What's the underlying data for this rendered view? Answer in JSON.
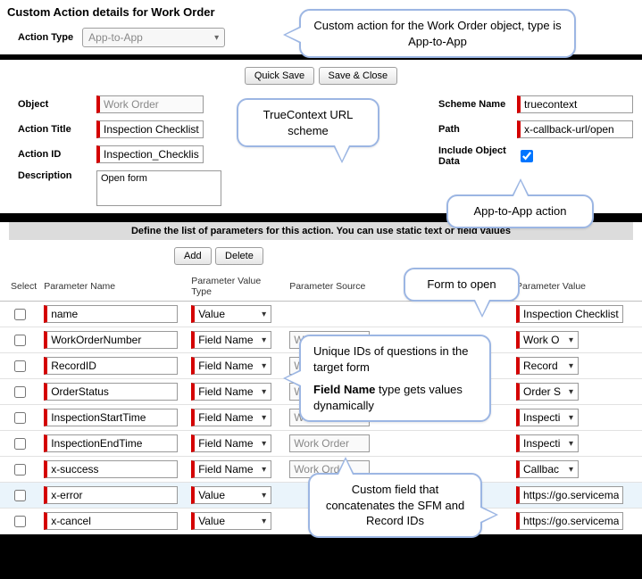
{
  "header": {
    "title": "Custom Action details for Work Order",
    "action_type_label": "Action Type",
    "action_type_value": "App-to-App"
  },
  "toolbar": {
    "quick_save": "Quick Save",
    "save_close": "Save & Close",
    "add": "Add",
    "delete": "Delete"
  },
  "form": {
    "object_label": "Object",
    "object_value": "Work Order",
    "action_title_label": "Action Title",
    "action_title_value": "Inspection Checklist",
    "action_id_label": "Action ID",
    "action_id_value": "Inspection_Checklist",
    "description_label": "Description",
    "description_value": "Open form",
    "scheme_name_label": "Scheme Name",
    "scheme_name_value": "truecontext",
    "path_label": "Path",
    "path_value": "x-callback-url/open",
    "include_label": "Include Object Data"
  },
  "section": {
    "params_header": "Define the list of parameters for this action. You can use static text or field values"
  },
  "cols": {
    "select": "Select",
    "pname": "Parameter Name",
    "ptype": "Parameter Value Type",
    "psrc": "Parameter Source",
    "pval": "Parameter Value"
  },
  "rows": [
    {
      "name": "name",
      "type": "Value",
      "src": "",
      "val": "Inspection Checklist",
      "val_is_drop": false,
      "sel": false
    },
    {
      "name": "WorkOrderNumber",
      "type": "Field Name",
      "src": "Work Order",
      "val": "Work O",
      "val_is_drop": true,
      "sel": false
    },
    {
      "name": "RecordID",
      "type": "Field Name",
      "src": "Work Order",
      "val": "Record",
      "val_is_drop": true,
      "sel": false
    },
    {
      "name": "OrderStatus",
      "type": "Field Name",
      "src": "Work Order",
      "val": "Order S",
      "val_is_drop": true,
      "sel": false
    },
    {
      "name": "InspectionStartTime",
      "type": "Field Name",
      "src": "Work Order",
      "val": "Inspecti",
      "val_is_drop": true,
      "sel": false
    },
    {
      "name": "InspectionEndTime",
      "type": "Field Name",
      "src": "Work Order",
      "val": "Inspecti",
      "val_is_drop": true,
      "sel": false
    },
    {
      "name": "x-success",
      "type": "Field Name",
      "src": "Work Order",
      "val": "Callbac",
      "val_is_drop": true,
      "sel": false
    },
    {
      "name": "x-error",
      "type": "Value",
      "src": "",
      "val": "https://go.servicemax.io/",
      "val_is_drop": false,
      "sel": true
    },
    {
      "name": "x-cancel",
      "type": "Value",
      "src": "",
      "val": "https://go.servicemax.io/",
      "val_is_drop": false,
      "sel": false
    }
  ],
  "callouts": {
    "c1": "Custom action for the Work Order object, type is App-to-App",
    "c2": "TrueContext URL scheme",
    "c3": "App-to-App action",
    "c4": "Form to open",
    "c5_a": "Unique IDs of questions in the target form",
    "c5_b": "Field Name",
    "c5_c": " type gets values dynamically",
    "c6": "Custom field that concatenates the SFM and Record IDs"
  }
}
